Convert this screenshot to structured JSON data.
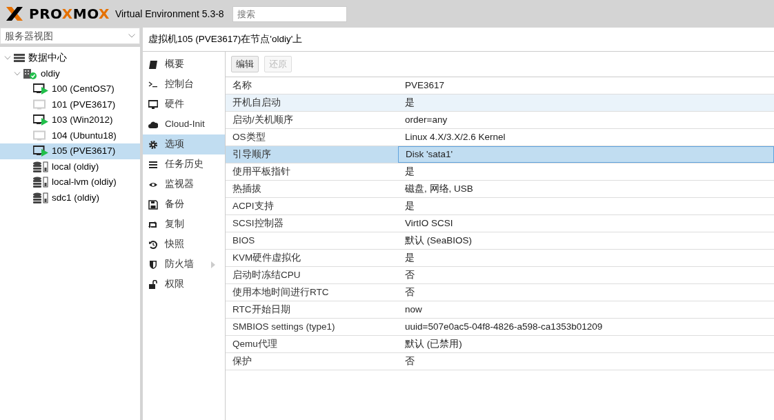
{
  "header": {
    "logo_parts": [
      {
        "text": "PRO",
        "accent": false
      },
      {
        "text": "X",
        "accent": true
      },
      {
        "text": "MO",
        "accent": false
      },
      {
        "text": "X",
        "accent": true
      }
    ],
    "version": "Virtual Environment 5.3-8",
    "search": {
      "placeholder": "搜索"
    }
  },
  "sidebar": {
    "view_select": "服务器视图",
    "tree": [
      {
        "label": "数据中心",
        "kind": "datacenter",
        "expanded": true,
        "selected": false,
        "children": [
          {
            "label": "oldiy",
            "kind": "node",
            "expanded": true,
            "selected": false,
            "children": [
              {
                "label": "100 (CentOS7)",
                "kind": "vm",
                "running": true,
                "selected": false
              },
              {
                "label": "101 (PVE3617)",
                "kind": "vm",
                "running": false,
                "selected": false
              },
              {
                "label": "103 (Win2012)",
                "kind": "vm",
                "running": true,
                "selected": false
              },
              {
                "label": "104 (Ubuntu18)",
                "kind": "vm",
                "running": false,
                "selected": false
              },
              {
                "label": "105 (PVE3617)",
                "kind": "vm",
                "running": true,
                "selected": true
              },
              {
                "label": "local (oldiy)",
                "kind": "storage",
                "selected": false
              },
              {
                "label": "local-lvm (oldiy)",
                "kind": "storage",
                "selected": false
              },
              {
                "label": "sdc1 (oldiy)",
                "kind": "storage",
                "selected": false
              }
            ]
          }
        ]
      }
    ]
  },
  "content": {
    "title": "虚拟机105 (PVE3617)在节点'oldiy'上",
    "menu": [
      {
        "label": "概要",
        "selected": false
      },
      {
        "label": "控制台",
        "selected": false
      },
      {
        "label": "硬件",
        "selected": false
      },
      {
        "label": "Cloud-Init",
        "selected": false
      },
      {
        "label": "选项",
        "selected": true
      },
      {
        "label": "任务历史",
        "selected": false
      },
      {
        "label": "监视器",
        "selected": false
      },
      {
        "label": "备份",
        "selected": false
      },
      {
        "label": "复制",
        "selected": false
      },
      {
        "label": "快照",
        "selected": false
      },
      {
        "label": "防火墙",
        "selected": false,
        "has_submenu": true
      },
      {
        "label": "权限",
        "selected": false
      }
    ],
    "toolbar": [
      {
        "label": "编辑",
        "disabled": false
      },
      {
        "label": "还原",
        "disabled": true
      }
    ],
    "options": [
      {
        "name": "名称",
        "value": "PVE3617",
        "selected": false,
        "hovered": false
      },
      {
        "name": "开机自启动",
        "value": "是",
        "selected": false,
        "hovered": true
      },
      {
        "name": "启动/关机顺序",
        "value": "order=any",
        "selected": false,
        "hovered": false
      },
      {
        "name": "OS类型",
        "value": "Linux 4.X/3.X/2.6 Kernel",
        "selected": false,
        "hovered": false
      },
      {
        "name": "引导顺序",
        "value": "Disk 'sata1'",
        "selected": true,
        "hovered": false
      },
      {
        "name": "使用平板指针",
        "value": "是",
        "selected": false,
        "hovered": false
      },
      {
        "name": "热插拔",
        "value": "磁盘, 网络, USB",
        "selected": false,
        "hovered": false
      },
      {
        "name": "ACPI支持",
        "value": "是",
        "selected": false,
        "hovered": false
      },
      {
        "name": "SCSI控制器",
        "value": "VirtIO SCSI",
        "selected": false,
        "hovered": false
      },
      {
        "name": "BIOS",
        "value": "默认 (SeaBIOS)",
        "selected": false,
        "hovered": false
      },
      {
        "name": "KVM硬件虚拟化",
        "value": "是",
        "selected": false,
        "hovered": false
      },
      {
        "name": "启动时冻结CPU",
        "value": "否",
        "selected": false,
        "hovered": false
      },
      {
        "name": "使用本地时间进行RTC",
        "value": "否",
        "selected": false,
        "hovered": false
      },
      {
        "name": "RTC开始日期",
        "value": "now",
        "selected": false,
        "hovered": false
      },
      {
        "name": "SMBIOS settings (type1)",
        "value": "uuid=507e0ac5-04f8-4826-a598-ca1353b01209",
        "selected": false,
        "hovered": false
      },
      {
        "name": "Qemu代理",
        "value": "默认 (已禁用)",
        "selected": false,
        "hovered": false
      },
      {
        "name": "保护",
        "value": "否",
        "selected": false,
        "hovered": false
      }
    ]
  }
}
